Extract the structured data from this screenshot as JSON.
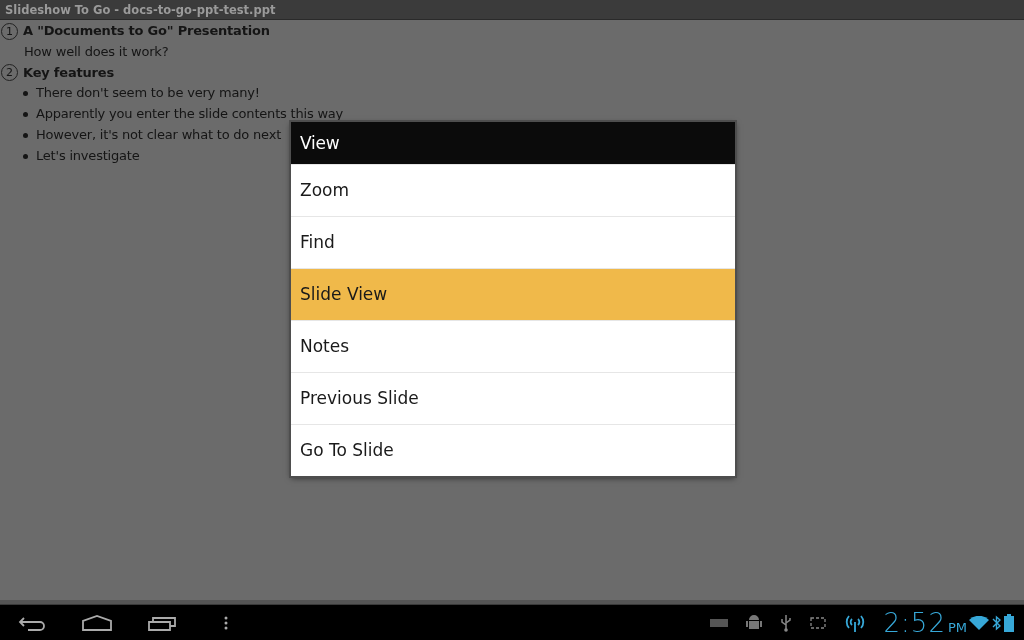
{
  "window": {
    "title": "Slideshow To Go - docs-to-go-ppt-test.ppt"
  },
  "outline": [
    {
      "number": "1",
      "title": "A \"Documents to Go\" Presentation",
      "subtitle": "How well does it work?"
    },
    {
      "number": "2",
      "title": "Key features",
      "bullets": [
        "There don't seem to be very many!",
        "Apparently you enter the slide contents this way",
        "However, it's not clear what to do next",
        "Let's investigate"
      ]
    }
  ],
  "menu": {
    "title": "View",
    "items": [
      {
        "label": "Zoom",
        "selected": false
      },
      {
        "label": "Find",
        "selected": false
      },
      {
        "label": "Slide View",
        "selected": true
      },
      {
        "label": "Notes",
        "selected": false
      },
      {
        "label": "Previous Slide",
        "selected": false
      },
      {
        "label": "Go To Slide",
        "selected": false
      }
    ]
  },
  "status_bar": {
    "time": "2:52",
    "ampm": "PM"
  }
}
